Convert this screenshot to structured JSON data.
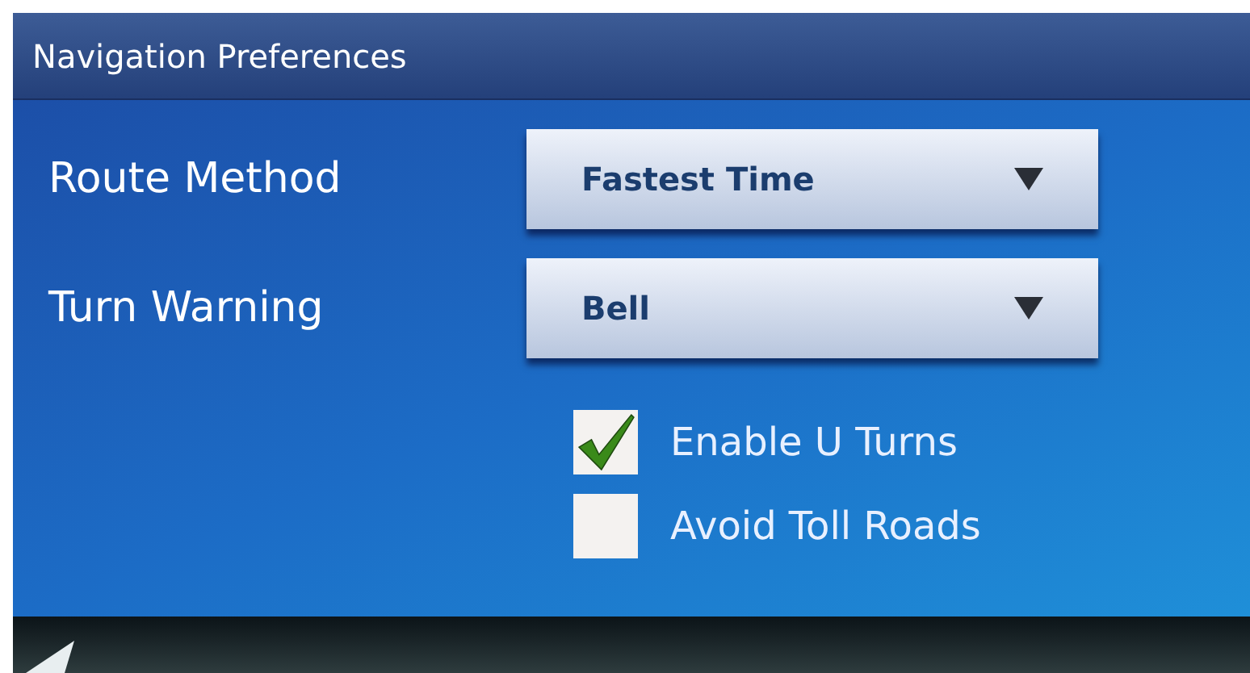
{
  "window": {
    "title": "Navigation Preferences"
  },
  "settings": [
    {
      "label": "Route Method",
      "value": "Fastest Time"
    },
    {
      "label": "Turn Warning",
      "value": "Bell"
    }
  ],
  "options": [
    {
      "label": "Enable U Turns",
      "checked": true
    },
    {
      "label": "Avoid Toll Roads",
      "checked": false
    }
  ]
}
